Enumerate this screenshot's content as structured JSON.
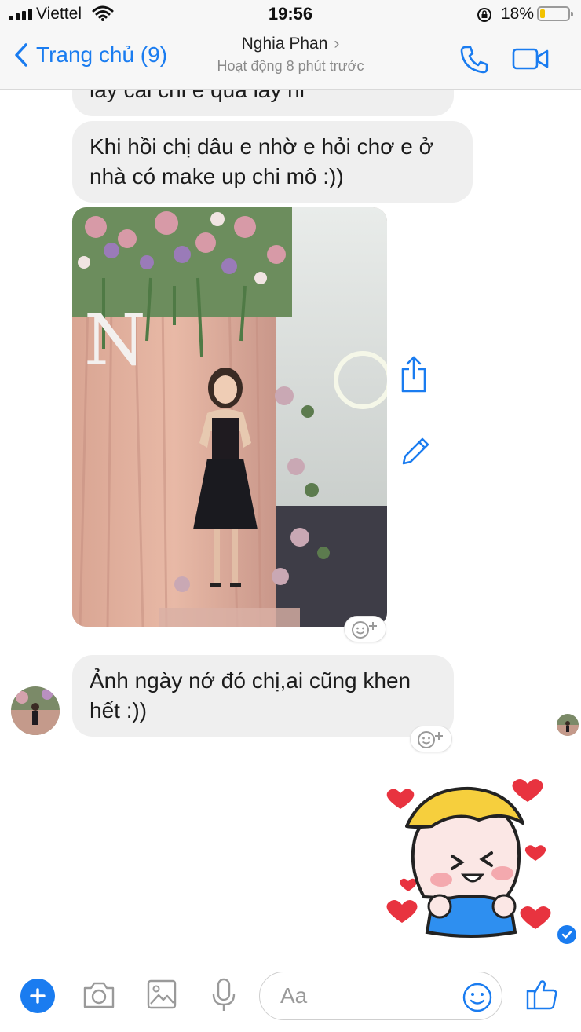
{
  "status_bar": {
    "carrier": "Viettel",
    "time": "19:56",
    "battery_percent": "18%",
    "battery_level": 0.18
  },
  "header": {
    "back_label": "Trang chủ (9)",
    "contact_name": "Nghia Phan",
    "contact_status": "Hoạt động 8 phút trước",
    "icons": [
      "chevron-left-icon",
      "chevron-right-icon",
      "phone-icon",
      "video-camera-icon"
    ]
  },
  "messages": {
    "previous_partial": "lay cai chi e qua lay hi",
    "msg1": "Khi hồi chị dâu e nhờ e hỏi chơ e ở nhà có make up chi mô :))",
    "msg2": "Ảnh ngày nớ đó chị,ai cũng khen hết :))",
    "react_icon": "add-reaction-icon"
  },
  "photo_actions": {
    "share_icon": "share-icon",
    "edit_icon": "pencil-icon"
  },
  "composer": {
    "placeholder": "Aa",
    "icons": [
      "plus-icon",
      "camera-icon",
      "image-icon",
      "microphone-icon",
      "emoji-icon",
      "thumbs-up-icon"
    ]
  },
  "colors": {
    "accent": "#1a7cf0",
    "bubble": "#efefef",
    "bar": "#f7f7f7"
  }
}
